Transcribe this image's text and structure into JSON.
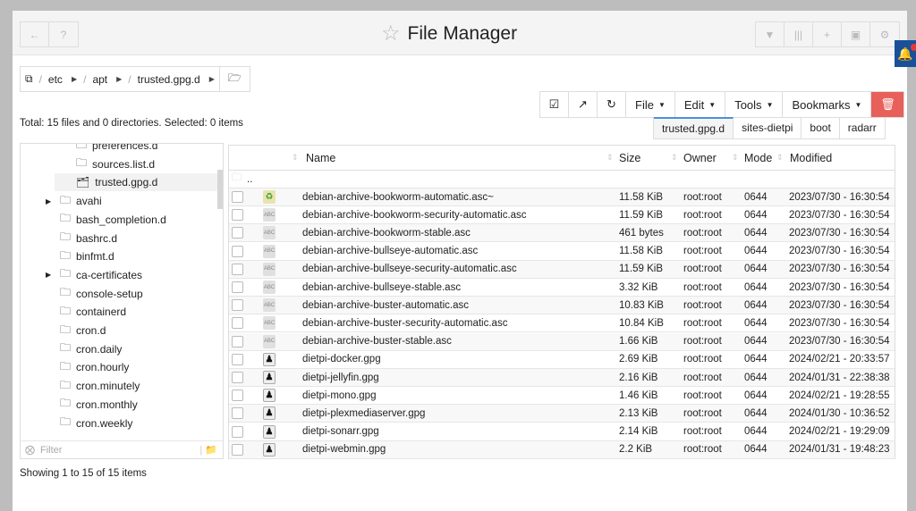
{
  "header": {
    "title": "File Manager",
    "left_icons": [
      "back-arrow-icon",
      "help-icon"
    ],
    "right_icons": [
      "filter-icon",
      "columns-icon",
      "plus-icon",
      "terminal-icon",
      "gear-icon"
    ]
  },
  "breadcrumb": {
    "items": [
      "etc",
      "apt",
      "trusted.gpg.d"
    ]
  },
  "toolbar": {
    "file": "File",
    "edit": "Edit",
    "tools": "Tools",
    "bookmarks": "Bookmarks"
  },
  "bookmark_tabs": [
    "trusted.gpg.d",
    "sites-dietpi",
    "boot",
    "radarr"
  ],
  "status": {
    "total": "Total: 15 files and 0 directories. Selected: 0 items",
    "showing": "Showing 1 to 15 of 15 items"
  },
  "tree": {
    "sub_items": [
      "preferences.d",
      "sources.list.d",
      "trusted.gpg.d"
    ],
    "items": [
      {
        "label": "avahi",
        "expandable": true
      },
      {
        "label": "bash_completion.d"
      },
      {
        "label": "bashrc.d"
      },
      {
        "label": "binfmt.d"
      },
      {
        "label": "ca-certificates",
        "expandable": true
      },
      {
        "label": "console-setup"
      },
      {
        "label": "containerd"
      },
      {
        "label": "cron.d"
      },
      {
        "label": "cron.daily"
      },
      {
        "label": "cron.hourly"
      },
      {
        "label": "cron.minutely"
      },
      {
        "label": "cron.monthly"
      },
      {
        "label": "cron.weekly"
      }
    ],
    "filter_placeholder": "Filter"
  },
  "table": {
    "columns": [
      "Name",
      "Size",
      "Owner",
      "Mode",
      "Modified"
    ],
    "parent": "..",
    "rows": [
      {
        "name": "debian-archive-bookworm-automatic.asc~",
        "size": "11.58 KiB",
        "owner": "root:root",
        "mode": "0644",
        "modified": "2023/07/30 - 16:30:54",
        "icon": "rec"
      },
      {
        "name": "debian-archive-bookworm-security-automatic.asc",
        "size": "11.59 KiB",
        "owner": "root:root",
        "mode": "0644",
        "modified": "2023/07/30 - 16:30:54",
        "icon": "txt"
      },
      {
        "name": "debian-archive-bookworm-stable.asc",
        "size": "461 bytes",
        "owner": "root:root",
        "mode": "0644",
        "modified": "2023/07/30 - 16:30:54",
        "icon": "txt"
      },
      {
        "name": "debian-archive-bullseye-automatic.asc",
        "size": "11.58 KiB",
        "owner": "root:root",
        "mode": "0644",
        "modified": "2023/07/30 - 16:30:54",
        "icon": "txt"
      },
      {
        "name": "debian-archive-bullseye-security-automatic.asc",
        "size": "11.59 KiB",
        "owner": "root:root",
        "mode": "0644",
        "modified": "2023/07/30 - 16:30:54",
        "icon": "txt"
      },
      {
        "name": "debian-archive-bullseye-stable.asc",
        "size": "3.32 KiB",
        "owner": "root:root",
        "mode": "0644",
        "modified": "2023/07/30 - 16:30:54",
        "icon": "txt"
      },
      {
        "name": "debian-archive-buster-automatic.asc",
        "size": "10.83 KiB",
        "owner": "root:root",
        "mode": "0644",
        "modified": "2023/07/30 - 16:30:54",
        "icon": "txt"
      },
      {
        "name": "debian-archive-buster-security-automatic.asc",
        "size": "10.84 KiB",
        "owner": "root:root",
        "mode": "0644",
        "modified": "2023/07/30 - 16:30:54",
        "icon": "txt"
      },
      {
        "name": "debian-archive-buster-stable.asc",
        "size": "1.66 KiB",
        "owner": "root:root",
        "mode": "0644",
        "modified": "2023/07/30 - 16:30:54",
        "icon": "txt"
      },
      {
        "name": "dietpi-docker.gpg",
        "size": "2.69 KiB",
        "owner": "root:root",
        "mode": "0644",
        "modified": "2024/02/21 - 20:33:57",
        "icon": "key"
      },
      {
        "name": "dietpi-jellyfin.gpg",
        "size": "2.16 KiB",
        "owner": "root:root",
        "mode": "0644",
        "modified": "2024/01/31 - 22:38:38",
        "icon": "key"
      },
      {
        "name": "dietpi-mono.gpg",
        "size": "1.46 KiB",
        "owner": "root:root",
        "mode": "0644",
        "modified": "2024/02/21 - 19:28:55",
        "icon": "key"
      },
      {
        "name": "dietpi-plexmediaserver.gpg",
        "size": "2.13 KiB",
        "owner": "root:root",
        "mode": "0644",
        "modified": "2024/01/30 - 10:36:52",
        "icon": "key"
      },
      {
        "name": "dietpi-sonarr.gpg",
        "size": "2.14 KiB",
        "owner": "root:root",
        "mode": "0644",
        "modified": "2024/02/21 - 19:29:09",
        "icon": "key"
      },
      {
        "name": "dietpi-webmin.gpg",
        "size": "2.2 KiB",
        "owner": "root:root",
        "mode": "0644",
        "modified": "2024/01/31 - 19:48:23",
        "icon": "key"
      }
    ]
  },
  "colors": {
    "delete": "#e8605a",
    "notify": "#1a4f9a",
    "tab_active": "#4a90d9"
  }
}
